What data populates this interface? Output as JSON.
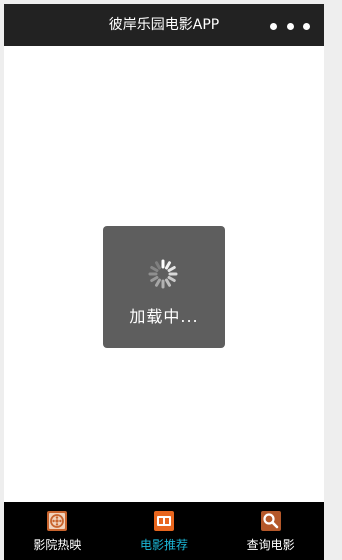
{
  "app": {
    "title": "彼岸乐园电影APP",
    "menu_icon": "more-dots-icon"
  },
  "loading": {
    "text": "加载中...",
    "icon": "loading-spinner-icon"
  },
  "tabbar": {
    "active_index": 1,
    "active_color": "#1bb6d6",
    "items": [
      {
        "label": "影院热映",
        "icon": "film-reel-icon"
      },
      {
        "label": "电影推荐",
        "icon": "film-strip-icon"
      },
      {
        "label": "查询电影",
        "icon": "search-icon"
      }
    ]
  }
}
